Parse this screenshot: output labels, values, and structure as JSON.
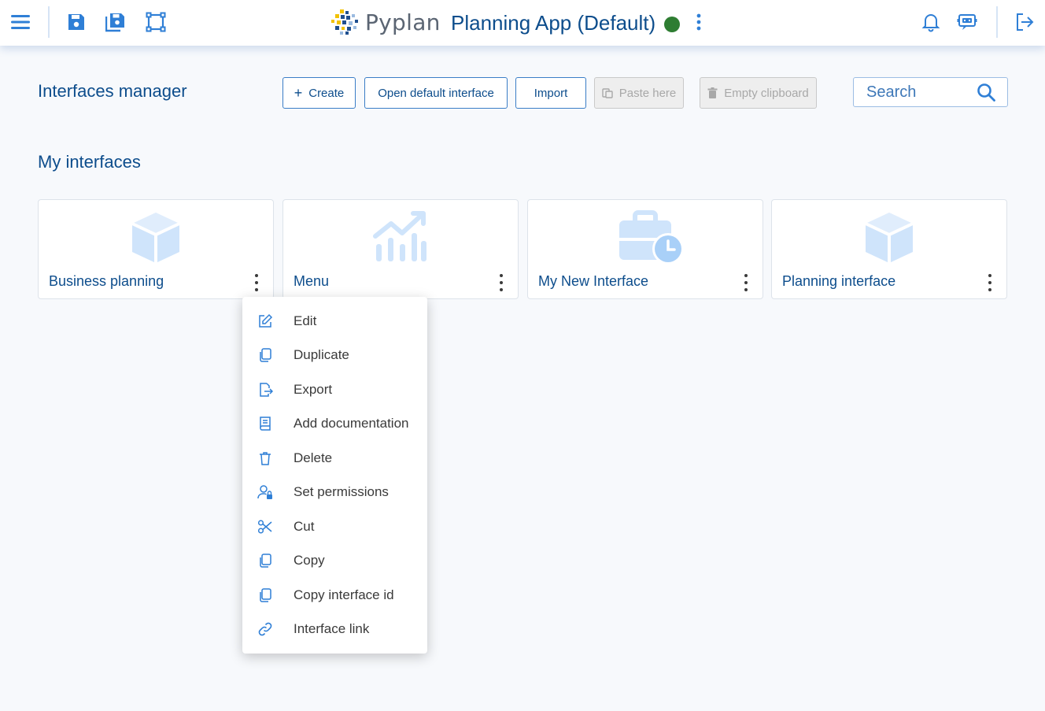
{
  "header": {
    "app_title": "Planning App (Default)",
    "logo_text": "Pyplan",
    "status_color": "#2e7d32",
    "icons": [
      "menu-icon",
      "save-icon",
      "save-as-icon",
      "vector-square-icon",
      "vertical-dots-icon",
      "bell-icon",
      "chat-bot-icon",
      "logout-icon"
    ]
  },
  "toolbar": {
    "page_title": "Interfaces manager",
    "create_label": "Create",
    "open_default_label": "Open default interface",
    "import_label": "Import",
    "paste_label": "Paste here",
    "empty_clipboard_label": "Empty clipboard",
    "search_placeholder": "Search"
  },
  "section": {
    "title": "My interfaces"
  },
  "cards": [
    {
      "label": "Business planning",
      "icon": "cube-icon"
    },
    {
      "label": "Menu",
      "icon": "chart-trend-icon"
    },
    {
      "label": "My New Interface",
      "icon": "briefcase-clock-icon"
    },
    {
      "label": "Planning interface",
      "icon": "cube-icon"
    }
  ],
  "context_menu": {
    "items": [
      {
        "label": "Edit",
        "icon": "edit-icon"
      },
      {
        "label": "Duplicate",
        "icon": "duplicate-icon"
      },
      {
        "label": "Export",
        "icon": "export-icon"
      },
      {
        "label": "Add documentation",
        "icon": "book-icon"
      },
      {
        "label": "Delete",
        "icon": "trash-icon"
      },
      {
        "label": "Set permissions",
        "icon": "user-lock-icon"
      },
      {
        "label": "Cut",
        "icon": "scissors-icon"
      },
      {
        "label": "Copy",
        "icon": "copy-icon"
      },
      {
        "label": "Copy interface id",
        "icon": "copy-id-icon"
      },
      {
        "label": "Interface link",
        "icon": "link-icon"
      }
    ]
  },
  "colors": {
    "primary": "#0d4d8c",
    "accent": "#2f7fd6",
    "icon_light": "#cfe4fb",
    "background": "#f7f9fc"
  }
}
